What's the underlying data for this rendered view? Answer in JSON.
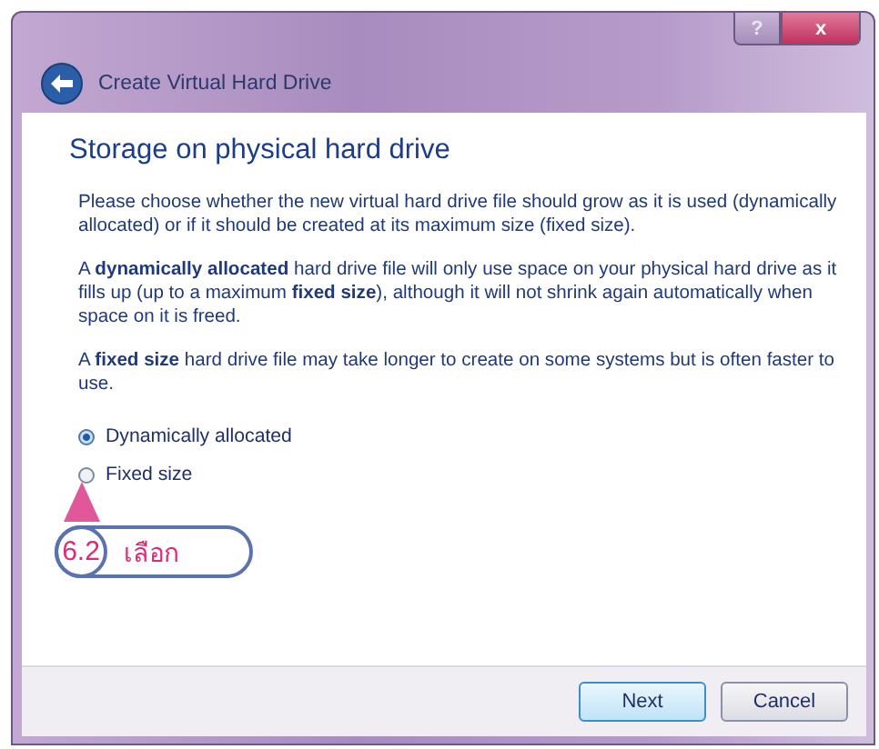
{
  "window": {
    "title": "Create Virtual Hard Drive",
    "help_button": "?",
    "close_button": "x"
  },
  "heading": "Storage on physical hard drive",
  "paragraphs": [
    "Please choose whether the new virtual hard drive file should grow as it is used (dynamically allocated) or if it should be created at its maximum size (fixed size).",
    "A **dynamically allocated** hard drive file will only use space on your physical hard drive as it fills up (up to a maximum **fixed size**), although it will not shrink again automatically when space on it is freed.",
    "A **fixed size** hard drive file may take longer to create on some systems but is often faster to use."
  ],
  "options": [
    {
      "label": "Dynamically allocated",
      "selected": true
    },
    {
      "label": "Fixed size",
      "selected": false
    }
  ],
  "annotation": {
    "step": "6.2",
    "text": "เลือก"
  },
  "buttons": [
    {
      "label": "Next",
      "kind": "default"
    },
    {
      "label": "Cancel",
      "kind": "normal"
    }
  ]
}
